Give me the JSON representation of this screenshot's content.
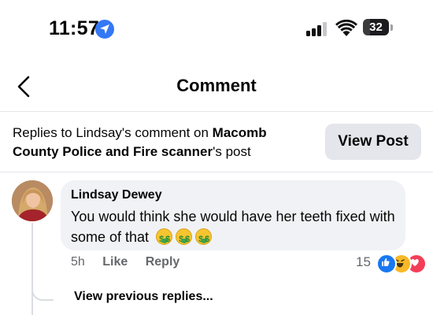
{
  "status_bar": {
    "time": "11:57",
    "battery": "32",
    "location_icon": "location-arrow-icon",
    "signal_icon": "cellular-signal-icon",
    "wifi_icon": "wifi-icon"
  },
  "nav": {
    "title": "Comment",
    "back_icon": "chevron-left-icon"
  },
  "context": {
    "prefix": "Replies to Lindsay's comment on ",
    "page_name": "Macomb County Police and Fire scanner",
    "suffix": "'s post",
    "view_post_label": "View Post"
  },
  "comment": {
    "author": "Lindsay Dewey",
    "text": "You would think she would have her teeth fixed with some of that",
    "emoji": "money-mouth-face",
    "emoji_count": 3,
    "time_ago": "5h",
    "like_label": "Like",
    "reply_label": "Reply",
    "reaction_count": "15",
    "reactions": [
      "like",
      "haha",
      "love"
    ]
  },
  "replies": {
    "view_previous_label": "View previous replies..."
  },
  "colors": {
    "accent_blue": "#1877f2",
    "bubble_bg": "#f0f2f5",
    "button_bg": "#e4e6eb",
    "secondary_text": "#65676b",
    "love_red": "#f33e58",
    "haha_yellow": "#f7b928"
  }
}
